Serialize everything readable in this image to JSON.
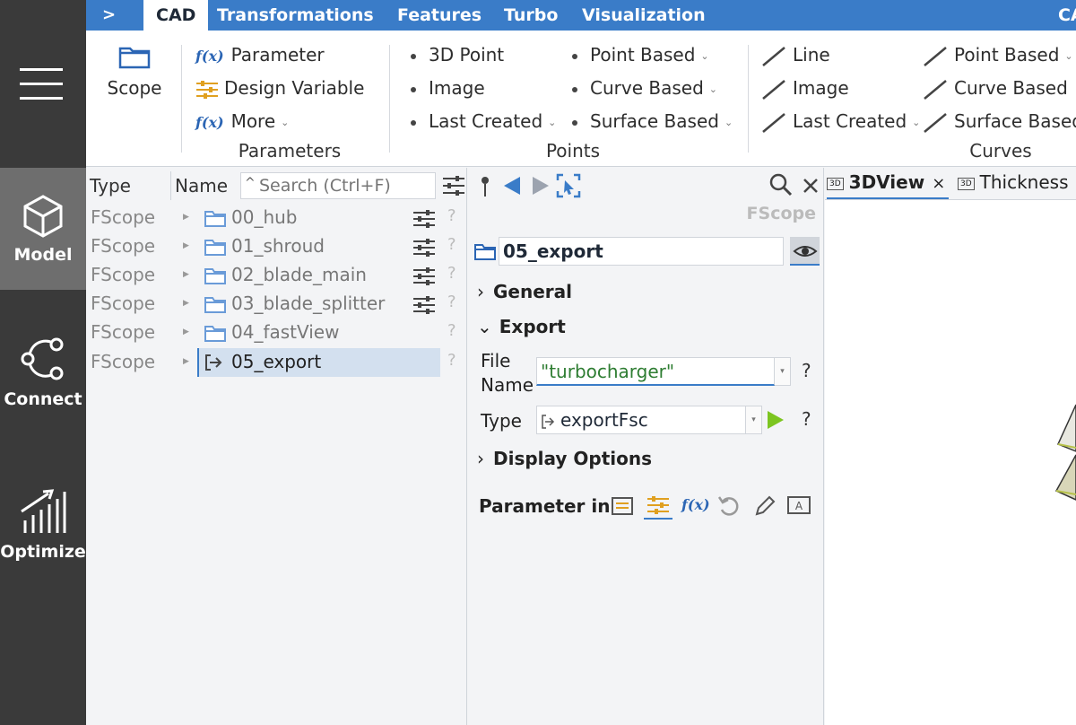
{
  "sidebar": {
    "items": [
      {
        "label": "Model",
        "icon": "cube-icon",
        "active": true
      },
      {
        "label": "Connect",
        "icon": "connect-icon"
      },
      {
        "label": "Optimize",
        "icon": "optimize-icon"
      }
    ]
  },
  "tabs": {
    "expand": ">",
    "items": [
      "CAD",
      "Transformations",
      "Features",
      "Turbo",
      "Visualization"
    ],
    "right_cut": "CA"
  },
  "ribbon": {
    "scope": "Scope",
    "parameters": {
      "items": [
        "Parameter",
        "Design Variable",
        "More"
      ],
      "group": "Parameters",
      "fx": "f(x)"
    },
    "points": {
      "col1": [
        "3D Point",
        "Image",
        "Last Created"
      ],
      "col2": [
        "Point Based",
        "Curve Based",
        "Surface Based"
      ],
      "group": "Points"
    },
    "curves": {
      "col1": [
        "Line",
        "Image",
        "Last Created"
      ],
      "col2": [
        "Point Based",
        "Curve Based",
        "Surface Based"
      ],
      "group": "Curves"
    }
  },
  "tree": {
    "header_type": "Type",
    "header_name": "Name",
    "search_placeholder": "Search (Ctrl+F)",
    "rows": [
      {
        "type": "FScope",
        "name": "00_hub"
      },
      {
        "type": "FScope",
        "name": "01_shroud"
      },
      {
        "type": "FScope",
        "name": "02_blade_main"
      },
      {
        "type": "FScope",
        "name": "03_blade_splitter"
      },
      {
        "type": "FScope",
        "name": "04_fastView"
      },
      {
        "type": "FScope",
        "name": "05_export"
      }
    ],
    "help": "?"
  },
  "props": {
    "type_label": "FScope",
    "object_name": "05_export",
    "sections": {
      "general": "General",
      "export": "Export",
      "display": "Display Options"
    },
    "file_label_1": "File",
    "file_label_2": "Name",
    "file_value": "\"turbocharger\"",
    "type_field_label": "Type",
    "type_value": "exportFsc",
    "help": "?",
    "param_in": "Parameter in",
    "fx": "f(x)"
  },
  "views": {
    "tab1": "3DView",
    "tab1_close": "×",
    "tab2": "Thickness",
    "badge": "3D"
  },
  "colors": {
    "accent": "#3a7cc8",
    "arrow": "#e02424",
    "play": "#7cc520",
    "string": "#2e7d32"
  }
}
